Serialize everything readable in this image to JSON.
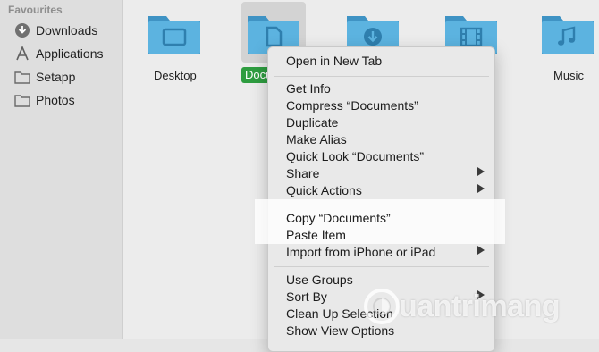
{
  "sidebar": {
    "header": "Favourites",
    "items": [
      {
        "label": "Downloads",
        "icon": "download-circle-icon"
      },
      {
        "label": "Applications",
        "icon": "applications-icon"
      },
      {
        "label": "Setapp",
        "icon": "folder-icon"
      },
      {
        "label": "Photos",
        "icon": "folder-icon"
      }
    ]
  },
  "folders": [
    {
      "label": "Desktop",
      "glyph": "desktop-icon"
    },
    {
      "label": "Documents",
      "short": "Docu",
      "glyph": "document-icon",
      "selected": true
    },
    {
      "label": "",
      "glyph": "download-icon"
    },
    {
      "label": "",
      "glyph": "film-icon"
    },
    {
      "label": "Music",
      "glyph": "music-note-icon"
    }
  ],
  "context_menu": {
    "items": [
      "Open in New Tab",
      "Get Info",
      "Compress “Documents”",
      "Duplicate",
      "Make Alias",
      "Quick Look “Documents”",
      "Share",
      "Quick Actions",
      "Copy “Documents”",
      "Paste Item",
      "Import from iPhone or iPad",
      "Use Groups",
      "Sort By",
      "Clean Up Selection",
      "Show View Options"
    ]
  },
  "watermark": {
    "text": "uantrimang"
  },
  "colors": {
    "folder": "#5cb3e0",
    "folder_dark": "#3f93c4",
    "selection": "#2e9d40"
  }
}
